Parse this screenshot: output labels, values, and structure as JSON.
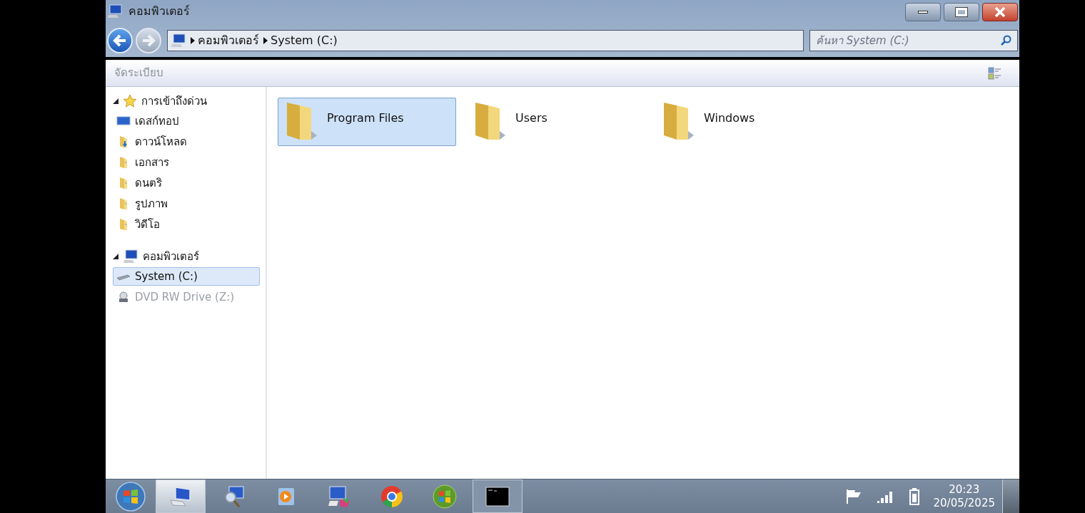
{
  "window": {
    "title": "คอมพิวเตอร์"
  },
  "address": {
    "crumbs": [
      "คอมพิวเตอร์",
      "System (C:)"
    ]
  },
  "search": {
    "placeholder": "ค้นหา System (C:)"
  },
  "toolbar": {
    "organize": "จัดระเบียบ"
  },
  "sidebar": {
    "groups": [
      {
        "label": "การเข้าถึงด่วน",
        "kind": "star",
        "expanded": true,
        "children": [
          {
            "label": "เดสก์ทอป",
            "kind": "desktop",
            "selected": false,
            "disabled": false
          },
          {
            "label": "ดาวน์โหลด",
            "kind": "download",
            "selected": false,
            "disabled": false
          },
          {
            "label": "เอกสาร",
            "kind": "folder",
            "selected": false,
            "disabled": false
          },
          {
            "label": "ดนตริ",
            "kind": "folder",
            "selected": false,
            "disabled": false
          },
          {
            "label": "รูปภาพ",
            "kind": "folder",
            "selected": false,
            "disabled": false
          },
          {
            "label": "วิดีโอ",
            "kind": "folder",
            "selected": false,
            "disabled": false
          }
        ]
      },
      {
        "label": "คอมพิวเตอร์",
        "kind": "computer",
        "expanded": true,
        "children": [
          {
            "label": "System (C:)",
            "kind": "drive",
            "selected": true,
            "disabled": false
          },
          {
            "label": "DVD RW Drive (Z:)",
            "kind": "dvd",
            "selected": false,
            "disabled": true
          }
        ]
      }
    ]
  },
  "folders": [
    {
      "name": "Program Files",
      "selected": true
    },
    {
      "name": "Users",
      "selected": false
    },
    {
      "name": "Windows",
      "selected": false
    }
  ],
  "taskbar": {
    "apps": [
      {
        "kind": "explorer",
        "selected": true,
        "running": true
      },
      {
        "kind": "search",
        "selected": false,
        "running": false
      },
      {
        "kind": "media",
        "selected": false,
        "running": false
      },
      {
        "kind": "display",
        "selected": false,
        "running": false
      },
      {
        "kind": "chrome",
        "selected": false,
        "running": false
      },
      {
        "kind": "windows",
        "selected": false,
        "running": false
      },
      {
        "kind": "terminal",
        "selected": false,
        "running": true
      }
    ],
    "time": "20:23",
    "date": "20/05/2025"
  }
}
